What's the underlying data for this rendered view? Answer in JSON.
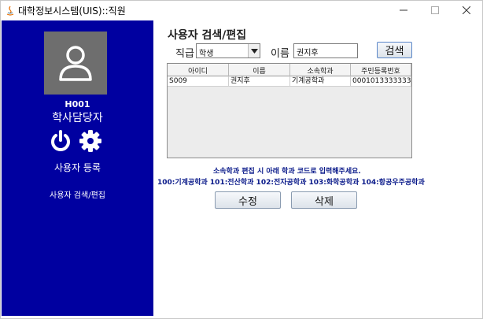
{
  "window": {
    "title": "대학정보시스템(UIS)::직원"
  },
  "sidebar": {
    "user_id": "H001",
    "user_role": "학사담당자",
    "menu": {
      "register": "사용자 등록",
      "search_edit": "사용자 검색/편집"
    },
    "colors": {
      "background": "#0000a0",
      "avatar": "#6e6e6e"
    }
  },
  "main": {
    "title": "사용자 검색/편집",
    "rank_label": "직급",
    "rank_value": "학생",
    "name_label": "이름",
    "name_value": "권지후",
    "search_button": "검색",
    "table": {
      "headers": [
        "아이디",
        "이름",
        "소속학과",
        "주민등록번호"
      ],
      "rows": [
        [
          "S009",
          "권지후",
          "기계공학과",
          "0001013333333"
        ]
      ]
    },
    "notice_line1": "소속학과 편집 시 아래 학과 코드로 입력해주세요.",
    "notice_line2": "100:기계공학과 101:전산학과 102:전자공학과 103:화학공학과 104:항공우주공학과",
    "edit_button": "수정",
    "delete_button": "삭제",
    "notice_color": "#0a1a8a"
  }
}
